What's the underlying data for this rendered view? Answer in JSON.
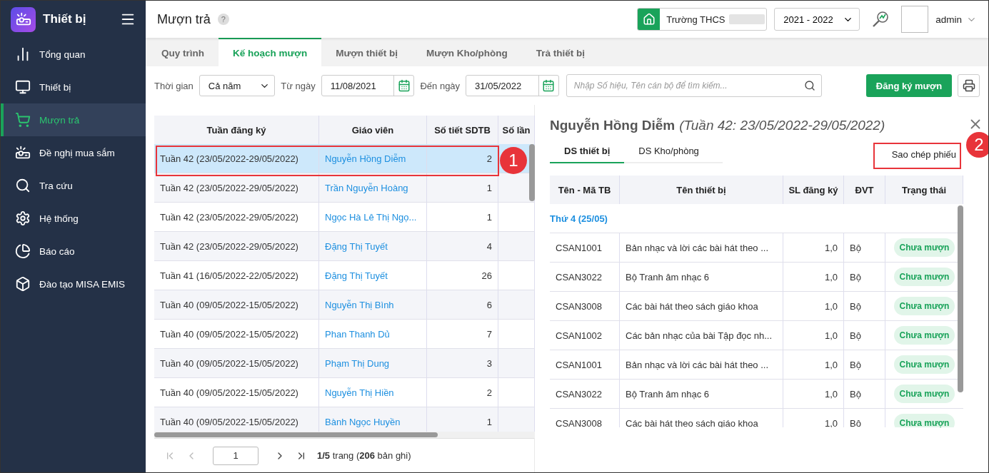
{
  "app": {
    "name": "Thiết bị"
  },
  "sidebar": {
    "items": [
      {
        "label": "Tổng quan",
        "selected": false
      },
      {
        "label": "Thiết bị",
        "selected": false
      },
      {
        "label": "Mượn trả",
        "selected": true
      },
      {
        "label": "Đề nghị mua sắm",
        "selected": false
      },
      {
        "label": "Tra cứu",
        "selected": false
      },
      {
        "label": "Hệ thống",
        "selected": false
      },
      {
        "label": "Báo cáo",
        "selected": false
      },
      {
        "label": "Đào tạo MISA EMIS",
        "selected": false
      }
    ]
  },
  "header": {
    "title": "Mượn trả",
    "help": "?",
    "school": "Trường THCS",
    "school_year": "2021 - 2022",
    "user": "admin"
  },
  "tabs": [
    {
      "label": "Quy trình",
      "selected": false
    },
    {
      "label": "Kế hoạch mượn",
      "selected": true
    },
    {
      "label": "Mượn thiết bị",
      "selected": false
    },
    {
      "label": "Mượn Kho/phòng",
      "selected": false
    },
    {
      "label": "Trả thiết bị",
      "selected": false
    }
  ],
  "filters": {
    "period_label": "Thời gian",
    "period": "Cả năm",
    "from_label": "Từ ngày",
    "from": "11/08/2021",
    "to_label": "Đến ngày",
    "to": "31/05/2022",
    "search_placeholder": "Nhập Số hiệu, Tên cán bộ để tìm kiếm...",
    "register_button": "Đăng ký mượn"
  },
  "table": {
    "columns": [
      "Tuần đăng ký",
      "Giáo viên",
      "Số tiết SDTB",
      "Số lần"
    ],
    "rows": [
      {
        "week": "Tuần 42 (23/05/2022-29/05/2022)",
        "teacher": "Nguyễn Hồng Diễm",
        "periods": "2",
        "selected": true
      },
      {
        "week": "Tuần 42 (23/05/2022-29/05/2022)",
        "teacher": "Trần Nguyễn Hoàng",
        "periods": "1",
        "selected": false
      },
      {
        "week": "Tuần 42 (23/05/2022-29/05/2022)",
        "teacher": "Ngọc Hà Lê Thị Ngọ...",
        "periods": "1",
        "selected": false
      },
      {
        "week": "Tuần 42 (23/05/2022-29/05/2022)",
        "teacher": "Đặng Thị Tuyết",
        "periods": "4",
        "selected": false
      },
      {
        "week": "Tuần 41 (16/05/2022-22/05/2022)",
        "teacher": "Đặng Thị Tuyết",
        "periods": "26",
        "selected": false
      },
      {
        "week": "Tuần 40 (09/05/2022-15/05/2022)",
        "teacher": "Nguyễn Thị Bình",
        "periods": "6",
        "selected": false
      },
      {
        "week": "Tuần 40 (09/05/2022-15/05/2022)",
        "teacher": "Phan Thanh Dủ",
        "periods": "7",
        "selected": false
      },
      {
        "week": "Tuần 40 (09/05/2022-15/05/2022)",
        "teacher": "Phạm Thị Dung",
        "periods": "3",
        "selected": false
      },
      {
        "week": "Tuần 40 (09/05/2022-15/05/2022)",
        "teacher": "Nguyễn Thị Hiền",
        "periods": "2",
        "selected": false
      },
      {
        "week": "Tuần 40 (09/05/2022-15/05/2022)",
        "teacher": "Bành Ngọc Huyền",
        "periods": "1",
        "selected": false
      }
    ]
  },
  "pagination": {
    "page": "1",
    "summary": "**1/5** trang (**206** bản ghi)"
  },
  "detail": {
    "teacher": "Nguyễn Hồng Diễm",
    "week": "(Tuần 42: 23/05/2022-29/05/2022)",
    "tabs": [
      {
        "label": "DS thiết bị",
        "selected": true
      },
      {
        "label": "DS Kho/phòng",
        "selected": false
      }
    ],
    "copy_button": "Sao chép phiếu",
    "columns": [
      "Tên - Mã TB",
      "Tên thiết bị",
      "SL đăng ký",
      "ĐVT",
      "Trạng thái"
    ],
    "groups": [
      {
        "label": "Thứ 4 (25/05)",
        "rows": [
          {
            "code": "CSAN1001",
            "name": "Bản nhạc và lời các bài hát theo ...",
            "qty": "1,0",
            "unit": "Bộ",
            "status": "Chưa mượn"
          },
          {
            "code": "CSAN3022",
            "name": "Bộ Tranh âm nhạc 6",
            "qty": "1,0",
            "unit": "Bộ",
            "status": "Chưa mượn"
          },
          {
            "code": "CSAN3008",
            "name": "Các bài hát theo sách giáo khoa",
            "qty": "1,0",
            "unit": "Bộ",
            "status": "Chưa mượn"
          },
          {
            "code": "CSAN1002",
            "name": "Các bản nhạc của bài Tập đọc nh...",
            "qty": "1,0",
            "unit": "Bộ",
            "status": "Chưa mượn"
          },
          {
            "code": "CSAN1001",
            "name": "Bản nhạc và lời các bài hát theo ...",
            "qty": "1,0",
            "unit": "Bộ",
            "status": "Chưa mượn"
          },
          {
            "code": "CSAN3022",
            "name": "Bộ Tranh âm nhạc 6",
            "qty": "1,0",
            "unit": "Bộ",
            "status": "Chưa mượn"
          },
          {
            "code": "CSAN3008",
            "name": "Các bài hát theo sách giáo khoa",
            "qty": "1,0",
            "unit": "Bộ",
            "status": "Chưa mượn"
          }
        ]
      }
    ]
  },
  "callouts": [
    {
      "label": "1"
    },
    {
      "label": "2"
    }
  ]
}
